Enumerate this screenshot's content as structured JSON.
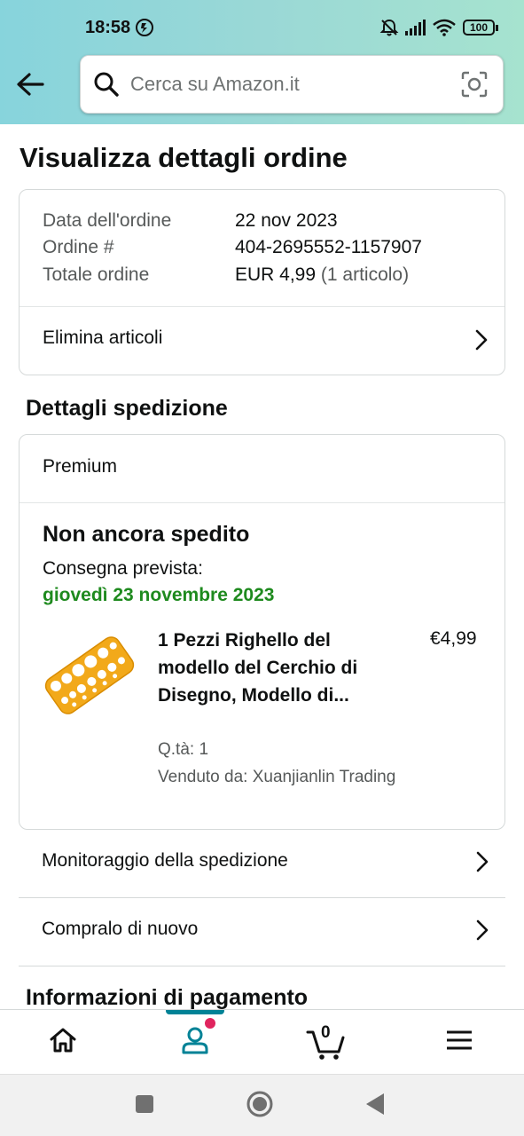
{
  "status_bar": {
    "time": "18:58",
    "battery": "100"
  },
  "search": {
    "placeholder": "Cerca su Amazon.it"
  },
  "page": {
    "title": "Visualizza dettagli ordine"
  },
  "order_summary": {
    "date_label": "Data dell'ordine",
    "date_value": "22 nov 2023",
    "number_label": "Ordine #",
    "number_value": "404-2695552-1157907",
    "total_label": "Totale ordine",
    "total_value": "EUR 4,99",
    "total_items": "(1 articolo)",
    "delete_items_label": "Elimina articoli"
  },
  "shipment": {
    "section_title": "Dettagli spedizione",
    "shipping_type": "Premium",
    "status": "Non ancora spedito",
    "delivery_label": "Consegna prevista:",
    "delivery_date": "giovedì 23 novembre 2023",
    "product": {
      "title": "1 Pezzi Righello del modello del Cerchio di Disegno, Modello di...",
      "price": "€4,99",
      "quantity": "Q.tà: 1",
      "seller": "Venduto da: Xuanjianlin Trading"
    },
    "track_label": "Monitoraggio della spedizione",
    "buy_again_label": "Compralo di nuovo"
  },
  "payment": {
    "section_title": "Informazioni di pagamento"
  },
  "bottom_nav": {
    "cart_count": "0",
    "items": [
      "home-icon",
      "account-icon",
      "cart-icon",
      "menu-icon"
    ]
  },
  "colors": {
    "accent": "#008296",
    "delivery_green": "#1e8a1e",
    "notification_dot": "#e0245e"
  }
}
